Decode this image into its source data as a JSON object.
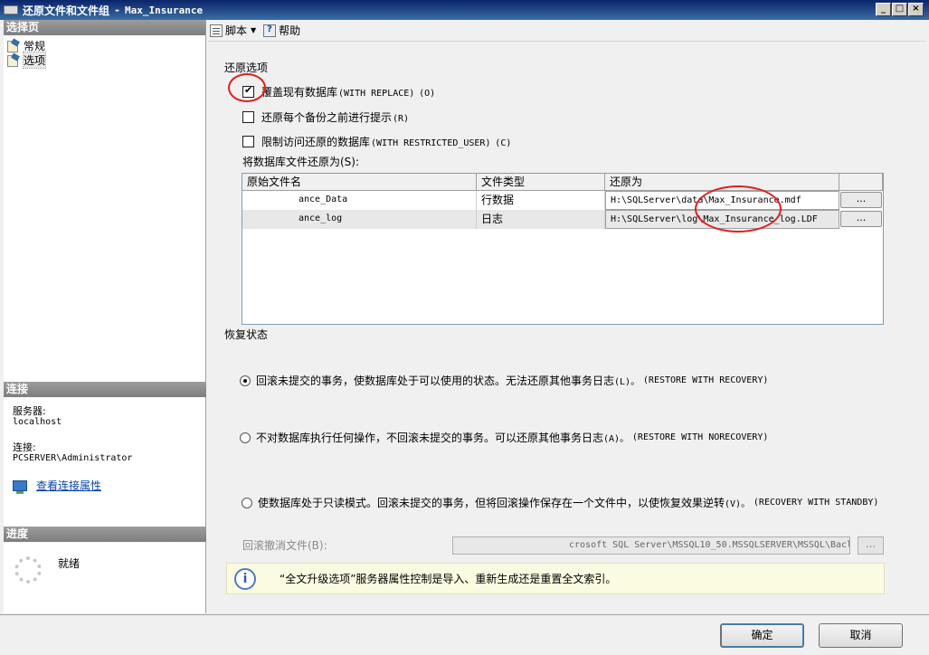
{
  "window": {
    "title": "还原文件和文件组",
    "db_name": "Max_Insurance",
    "controls": [
      "_",
      "□",
      "×"
    ]
  },
  "sidebar": {
    "header": "选择页",
    "pages": [
      {
        "label": "常规"
      },
      {
        "label": "选项"
      }
    ],
    "connection": {
      "header": "连接",
      "server_label": "服务器:",
      "server_value": "localhost",
      "conn_label": "连接:",
      "conn_value": "PCSERVER\\Administrator",
      "view_link": "查看连接属性"
    },
    "progress": {
      "header": "进度",
      "status": "就绪"
    }
  },
  "toolbar": {
    "script_label": "脚本",
    "help_label": "帮助"
  },
  "restore_options": {
    "header": "还原选项",
    "options": [
      {
        "label": "覆盖现有数据库",
        "code": "(WITH REPLACE)",
        "key": "(O)",
        "checked": true
      },
      {
        "label": "还原每个备份之前进行提示",
        "code": "",
        "key": "(R)",
        "checked": false
      },
      {
        "label": "限制访问还原的数据库",
        "code": "(WITH RESTRICTED_USER)",
        "key": "(C)",
        "checked": false
      }
    ]
  },
  "files": {
    "label": "将数据库文件还原为(S):",
    "columns": [
      "原始文件名",
      "文件类型",
      "还原为",
      ""
    ],
    "rows": [
      {
        "orig": "ance_Data",
        "type": "行数据",
        "restore_as": "H:\\SQLServer\\data\\Max_Insurance.mdf",
        "btn": "..."
      },
      {
        "orig": "ance_log",
        "type": "日志",
        "restore_as": "H:\\SQLServer\\log\\Max_Insurance_log.LDF",
        "btn": "..."
      }
    ]
  },
  "recovery": {
    "header": "恢复状态",
    "options": [
      {
        "label": "回滚未提交的事务，使数据库处于可以使用的状态。无法还原其他事务日志",
        "key": "(L)。",
        "code": "(RESTORE WITH RECOVERY)",
        "selected": true
      },
      {
        "label": "不对数据库执行任何操作，不回滚未提交的事务。可以还原其他事务日志",
        "key": "(A)。",
        "code": "(RESTORE WITH NORECOVERY)",
        "selected": false
      },
      {
        "label": "使数据库处于只读模式。回滚未提交的事务，但将回滚操作保存在一个文件中，以使恢复效果逆转",
        "key": "(V)。",
        "code": "(RECOVERY WITH STANDBY)",
        "selected": false
      }
    ],
    "undo_file_label": "回滚撤消文件(B):",
    "undo_file_value": "crosoft SQL Server\\MSSQL10_50.MSSQLSERVER\\MSSQL\\Bacl",
    "undo_btn": "..."
  },
  "info": {
    "icon": "i",
    "text": "“全文升级选项”服务器属性控制是导入、重新生成还是重置全文索引。"
  },
  "buttons": {
    "ok": "确定",
    "cancel": "取消"
  },
  "colors": {
    "annotation": "#e02020",
    "title_bar": "#0a246a"
  }
}
